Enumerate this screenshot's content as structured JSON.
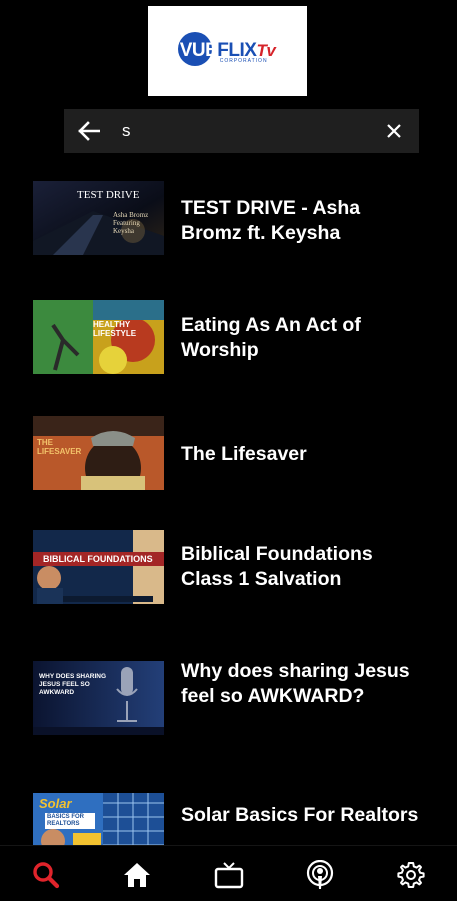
{
  "header": {
    "logo": {
      "brand_part1": "VUE",
      "brand_part2": "FLIX",
      "brand_part3": "Tv",
      "sub": "CORPORATION"
    }
  },
  "search": {
    "value": "s",
    "back_icon": "arrow-left-icon",
    "clear_icon": "close-icon"
  },
  "results": [
    {
      "title": "TEST DRIVE - Asha Bromz ft. Keysha",
      "thumb_text": "TEST DRIVE",
      "thumb_sub": "Asha Bromz Featuring Keysha",
      "colors": [
        "#0b0f1c",
        "#2b3a5e",
        "#c9a96a"
      ]
    },
    {
      "title": "Eating As An Act of Worship",
      "thumb_text": "HEALTHY LIFESTYLE",
      "thumb_sub": "",
      "colors": [
        "#2f7a3a",
        "#d9a21c",
        "#b7331f"
      ]
    },
    {
      "title": "The Lifesaver",
      "thumb_text": "THE LIFESAVER",
      "thumb_sub": "",
      "colors": [
        "#1b1410",
        "#a0522d",
        "#d86a2a"
      ]
    },
    {
      "title": "Biblical Foundations Class 1 Salvation",
      "thumb_text": "BIBLICAL FOUNDATIONS",
      "thumb_sub": "",
      "colors": [
        "#0f2746",
        "#b02a2a",
        "#e3c38a"
      ]
    },
    {
      "title": "Why does sharing Jesus feel so AWKWARD?",
      "thumb_text": "WHY DOES SHARING JESUS FEEL SO AWKWARD",
      "thumb_sub": "",
      "colors": [
        "#0b1430",
        "#1e3b73",
        "#4a5a80"
      ]
    },
    {
      "title": "Solar Basics For Realtors",
      "thumb_text": "Solar",
      "thumb_sub": "BASICS FOR REALTORS",
      "colors": [
        "#2f6fc0",
        "#e9f0f8",
        "#f2c230"
      ]
    }
  ],
  "bottom_nav": [
    {
      "name": "search",
      "icon": "search-icon",
      "active": true
    },
    {
      "name": "home",
      "icon": "home-icon",
      "active": false
    },
    {
      "name": "tv",
      "icon": "tv-icon",
      "active": false
    },
    {
      "name": "podcast",
      "icon": "podcast-icon",
      "active": false
    },
    {
      "name": "settings",
      "icon": "gear-icon",
      "active": false
    }
  ],
  "colors": {
    "accent": "#e0242b",
    "background": "#000000",
    "search_bg": "#1f1f1f"
  }
}
